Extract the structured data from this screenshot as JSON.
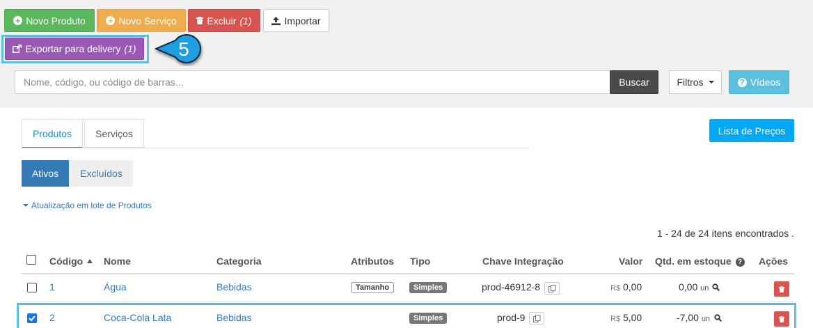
{
  "toolbar": {
    "novo_produto": "Novo Produto",
    "novo_servico": "Novo Serviço",
    "excluir": "Excluir",
    "excluir_count": "(1)",
    "importar": "Importar",
    "exportar": "Exportar para delivery",
    "exportar_count": "(1)"
  },
  "step_badge": "5",
  "search": {
    "placeholder": "Nome, código, ou código de barras...",
    "value": "",
    "button": "Buscar",
    "filtros": "Filtros",
    "videos": "Vídeos"
  },
  "tabs": [
    {
      "label": "Produtos",
      "active": true
    },
    {
      "label": "Serviços",
      "active": false
    }
  ],
  "lista_precos": "Lista de Preços",
  "status_pills": [
    {
      "label": "Ativos",
      "active": true
    },
    {
      "label": "Excluídos",
      "active": false
    }
  ],
  "lote_link": "Atualização em lote de Produtos",
  "count_text": "1 - 24 de 24 itens encontrados .",
  "table": {
    "headers": {
      "codigo": "Código",
      "nome": "Nome",
      "categoria": "Categoria",
      "atributos": "Atributos",
      "tipo": "Tipo",
      "chave": "Chave Integração",
      "valor": "Valor",
      "qtd": "Qtd. em estoque",
      "acoes": "Ações"
    },
    "rows": [
      {
        "checked": false,
        "codigo": "1",
        "nome": "Água",
        "categoria": "Bebidas",
        "atributo": "Tamanho",
        "tipo": "Simples",
        "chave": "prod-46912-8",
        "currency": "R$",
        "valor": "0,00",
        "qtd": "0,00",
        "unit": "un"
      },
      {
        "checked": true,
        "codigo": "2",
        "nome": "Coca-Cola Lata",
        "categoria": "Bebidas",
        "atributo": "",
        "tipo": "Simples",
        "chave": "prod-9",
        "currency": "R$",
        "valor": "5,00",
        "qtd": "-7,00",
        "unit": "un"
      }
    ]
  },
  "colors": {
    "success": "#5cb85c",
    "warning": "#f0ad4e",
    "danger": "#d9534f",
    "purple": "#9b59b6",
    "info": "#5bc0de",
    "primary": "#337ab7",
    "highlight": "#5bc0de"
  }
}
